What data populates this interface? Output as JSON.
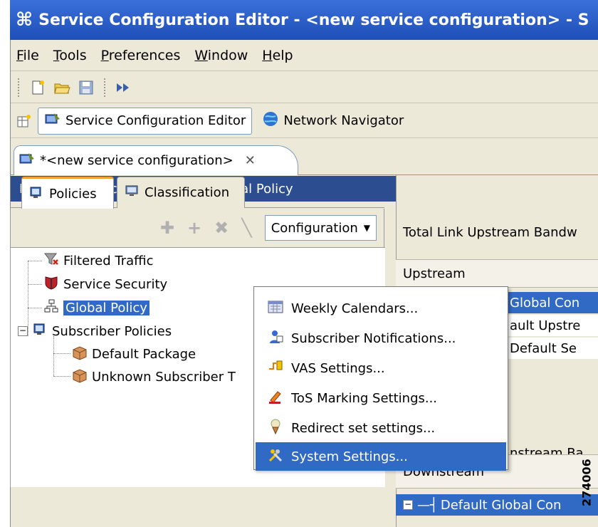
{
  "window": {
    "title": "Service Configuration Editor - <new service configuration> - S"
  },
  "menu": [
    "File",
    "Tools",
    "Preferences",
    "Window",
    "Help"
  ],
  "toolbar": {
    "icons": [
      "new-file-icon",
      "open-folder-icon",
      "save-icon",
      "forward-arrows-icon"
    ]
  },
  "perspectives": {
    "service_editor": "Service Configuration Editor",
    "network_navigator": "Network Navigator"
  },
  "editor_tab": {
    "label": "*<new service configuration>"
  },
  "breadcrumb": "Policies : Subscriber Policies : Global Policy",
  "left_tabs": {
    "policies": "Policies",
    "classification": "Classification"
  },
  "config_button": {
    "label": "Configuration"
  },
  "tree": {
    "filtered_traffic": "Filtered Traffic",
    "service_security": "Service Security",
    "global_policy": "Global Policy",
    "subscriber_policies": "Subscriber Policies",
    "default_package": "Default Package",
    "unknown_subscriber": "Unknown Subscriber T"
  },
  "right_pane": {
    "total_link": "Total Link Upstream Bandw",
    "upstream": "Upstream",
    "row1": "Global Con",
    "row2": "ault Upstre",
    "row3": "Default Se",
    "downstream_band": "nstream Ba",
    "downstream": "Downstream",
    "default_global": "Default Global Con"
  },
  "dropdown": {
    "weekly_calendars": "Weekly Calendars...",
    "subscriber_notifications": "Subscriber Notifications...",
    "vas_settings": "VAS Settings...",
    "tos_marking": "ToS Marking Settings...",
    "redirect_settings": "Redirect set settings...",
    "system_settings": "System Settings..."
  },
  "watermark": "274006",
  "colors": {
    "title": "#2a5ed0",
    "breadcrumb": "#2c4d8f",
    "selection": "#316ac5"
  }
}
